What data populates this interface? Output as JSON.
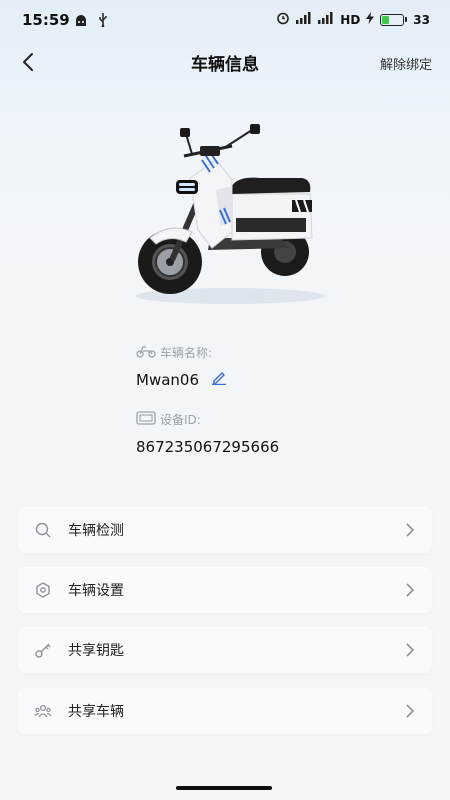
{
  "status_bar": {
    "time": "15:59",
    "network_label": "HD",
    "battery_level": "33",
    "battery_fraction": 0.33
  },
  "header": {
    "title": "车辆信息",
    "unbind_label": "解除绑定"
  },
  "vehicle": {
    "name_label": "车辆名称:",
    "name_value": "Mwan06",
    "device_label": "设备ID:",
    "device_value": "867235067295666"
  },
  "menu": {
    "items": [
      {
        "label": "车辆检测",
        "icon": "search-icon"
      },
      {
        "label": "车辆设置",
        "icon": "settings-icon"
      },
      {
        "label": "共享钥匙",
        "icon": "key-icon"
      },
      {
        "label": "共享车辆",
        "icon": "people-icon"
      }
    ]
  },
  "colors": {
    "accent_blue": "#3b6fd8",
    "battery_green": "#3ecb4a"
  }
}
